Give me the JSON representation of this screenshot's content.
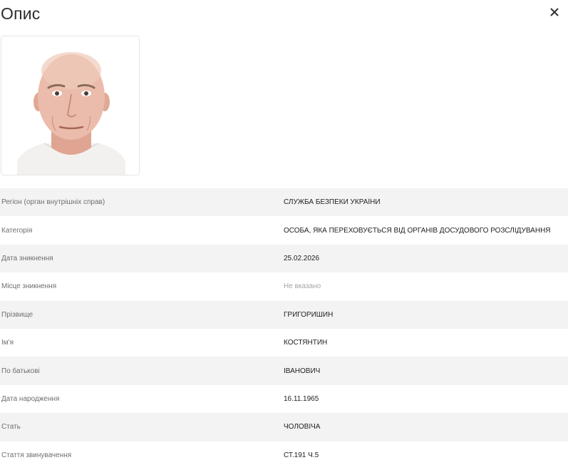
{
  "modal": {
    "title": "Опис",
    "close_icon": "close-icon"
  },
  "photo": {
    "alt": "Фото особи",
    "background": "#ffffff",
    "skin": "#e9b9a8",
    "shirt": "#f4f2f1"
  },
  "details": [
    {
      "label": "Регіон (орган внутрішніх справ)",
      "value": "СЛУЖБА БЕЗПЕКИ УКРАЇНИ",
      "muted": false
    },
    {
      "label": "Категорія",
      "value": "ОСОБА, ЯКА ПЕРЕХОВУЄТЬСЯ ВІД ОРГАНІВ ДОСУДОВОГО РОЗСЛІДУВАННЯ",
      "muted": false
    },
    {
      "label": "Дата зникнення",
      "value": "25.02.2026",
      "muted": false
    },
    {
      "label": "Місце зникнення",
      "value": "Не вказано",
      "muted": true
    },
    {
      "label": "Прізвище",
      "value": "ГРИГОРИШИН",
      "muted": false
    },
    {
      "label": "Ім'я",
      "value": "КОСТЯНТИН",
      "muted": false
    },
    {
      "label": "По батькові",
      "value": "ІВАНОВИЧ",
      "muted": false
    },
    {
      "label": "Дата народження",
      "value": "16.11.1965",
      "muted": false
    },
    {
      "label": "Стать",
      "value": "ЧОЛОВІЧА",
      "muted": false
    },
    {
      "label": "Стаття звинувачення",
      "value": "СТ.191 Ч.5",
      "muted": false
    }
  ],
  "colors": {
    "row_stripe": "#f3f3f3",
    "label_text": "#6e6e6e",
    "value_text": "#222222",
    "muted_text": "#a3a3a3"
  }
}
